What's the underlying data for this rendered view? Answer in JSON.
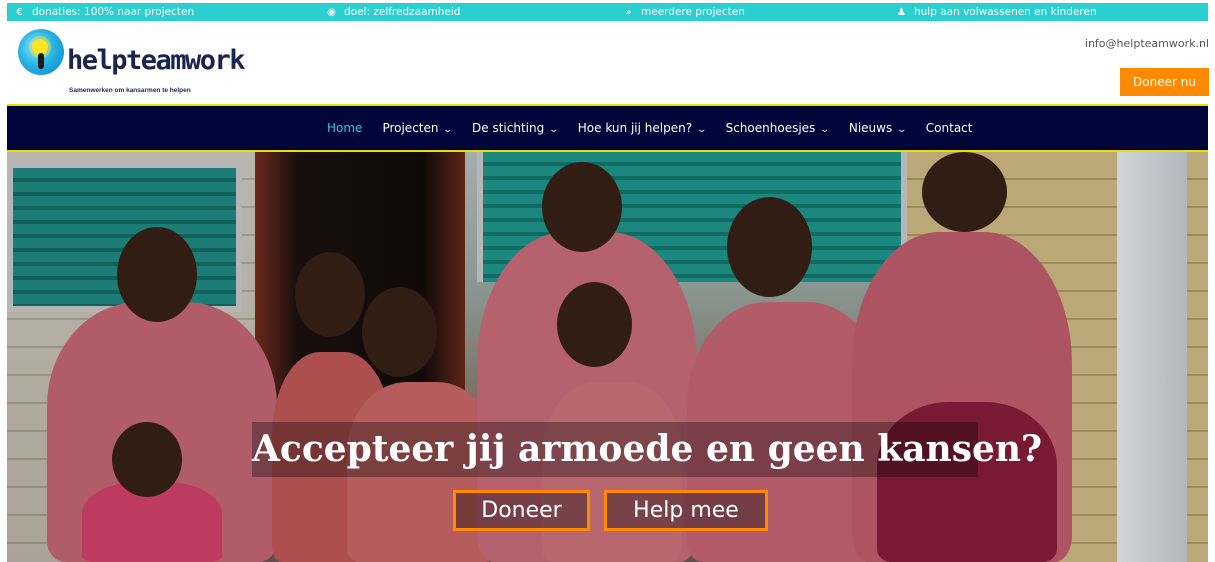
{
  "topbar": {
    "items": [
      {
        "icon": "euro-icon",
        "glyph": "€",
        "label": "donaties: 100% naar projecten"
      },
      {
        "icon": "target-icon",
        "glyph": "◉",
        "label": "doel: zelfredzaamheid"
      },
      {
        "icon": "double-chevron-icon",
        "glyph": "»",
        "label": "meerdere projecten"
      },
      {
        "icon": "people-icon",
        "glyph": "♟",
        "label": "hulp aan volwassenen en kinderen"
      }
    ]
  },
  "header": {
    "logo_text": "helpteamwork",
    "logo_tagline": "Samenwerken om kansarmen te helpen",
    "email": "info@helpteamwork.nl",
    "donate_label": "Doneer nu"
  },
  "nav": {
    "items": [
      {
        "label": "Home",
        "dropdown": false,
        "active": true
      },
      {
        "label": "Projecten",
        "dropdown": true,
        "active": false
      },
      {
        "label": "De stichting",
        "dropdown": true,
        "active": false
      },
      {
        "label": "Hoe kun jij helpen?",
        "dropdown": true,
        "active": false
      },
      {
        "label": "Schoenhoesjes",
        "dropdown": true,
        "active": false
      },
      {
        "label": "Nieuws",
        "dropdown": true,
        "active": false
      },
      {
        "label": "Contact",
        "dropdown": false,
        "active": false
      }
    ]
  },
  "hero": {
    "headline": "Accepteer jij armoede en geen kansen?",
    "cta_primary": "Doneer",
    "cta_secondary": "Help mee"
  },
  "colors": {
    "accent_teal": "#2ccfd0",
    "nav_bg": "#000639",
    "nav_border": "#e8e000",
    "cta_orange": "#ff8a00"
  }
}
